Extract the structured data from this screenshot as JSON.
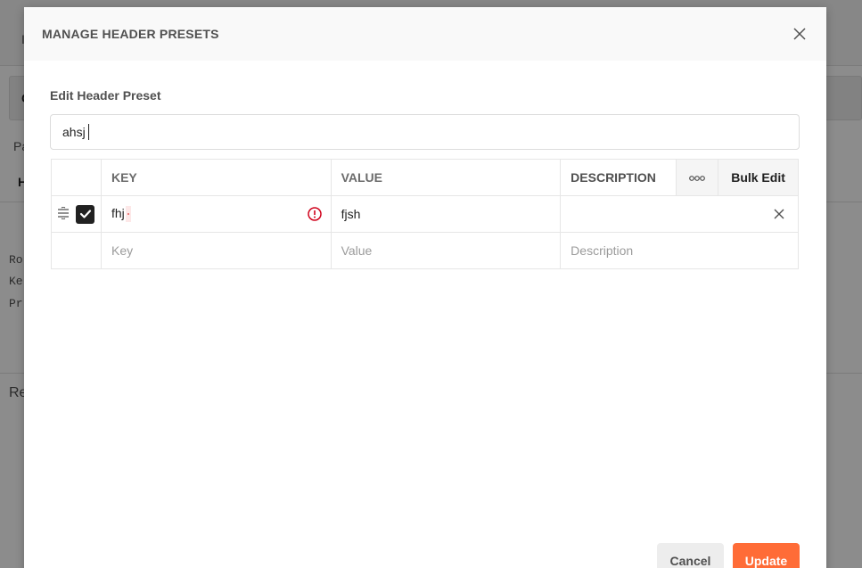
{
  "background": {
    "tab_fragment": "I",
    "fragment_c": "C",
    "fragment_pa": "Pa",
    "fragment_h": "H",
    "mono_lines": [
      "Ro",
      "Ke",
      "Pr"
    ],
    "fragment_re": "Re"
  },
  "modal": {
    "title": "MANAGE HEADER PRESETS",
    "section_label": "Edit Header Preset",
    "preset_name_value": "ahsj",
    "table": {
      "columns": {
        "key": "KEY",
        "value": "VALUE",
        "description": "DESCRIPTION",
        "more": "ooo",
        "bulk_edit": "Bulk Edit"
      },
      "rows": [
        {
          "checked": true,
          "key": "fhj",
          "value": "fjsh",
          "description": ""
        }
      ],
      "placeholders": {
        "key": "Key",
        "value": "Value",
        "description": "Description"
      }
    },
    "buttons": {
      "cancel": "Cancel",
      "update": "Update"
    }
  },
  "colors": {
    "accent": "#ff6c37",
    "warning": "#d0021b"
  }
}
